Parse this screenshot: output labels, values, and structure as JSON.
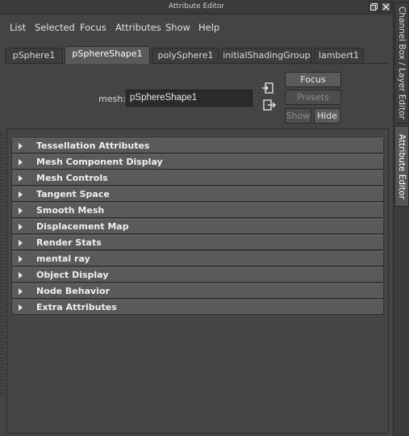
{
  "window": {
    "title": "Attribute Editor"
  },
  "menubar": {
    "items": [
      "List",
      "Selected",
      "Focus",
      "Attributes",
      "Show",
      "Help"
    ]
  },
  "tabs": [
    {
      "label": "pSphere1",
      "active": false
    },
    {
      "label": "pSphereShape1",
      "active": true
    },
    {
      "label": "polySphere1",
      "active": false
    },
    {
      "label": "initialShadingGroup",
      "active": false
    },
    {
      "label": "lambert1",
      "active": false
    }
  ],
  "node": {
    "type_label": "mesh:",
    "name": "pSphereShape1"
  },
  "buttons": {
    "focus": "Focus",
    "presets": "Presets",
    "show": "Show",
    "hide": "Hide"
  },
  "sections": [
    "Tessellation Attributes",
    "Mesh Component Display",
    "Mesh Controls",
    "Tangent Space",
    "Smooth Mesh",
    "Displacement Map",
    "Render Stats",
    "mental ray",
    "Object Display",
    "Node Behavior",
    "Extra Attributes"
  ],
  "side_tabs": {
    "channel_box": "Channel Box / Layer Editor",
    "attribute_editor": "Attribute Editor"
  }
}
